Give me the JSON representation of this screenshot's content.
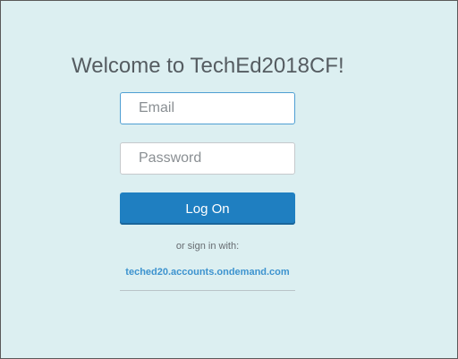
{
  "welcome": "Welcome to TechEd2018CF!",
  "form": {
    "email_placeholder": "Email",
    "password_placeholder": "Password",
    "logon_label": "Log On"
  },
  "alt_signin": {
    "prompt": "or sign in with:",
    "provider_link": "teched20.accounts.ondemand.com"
  },
  "colors": {
    "background": "#dceff1",
    "button": "#1f7fc1",
    "link": "#3d93cf",
    "heading": "#555c61"
  }
}
